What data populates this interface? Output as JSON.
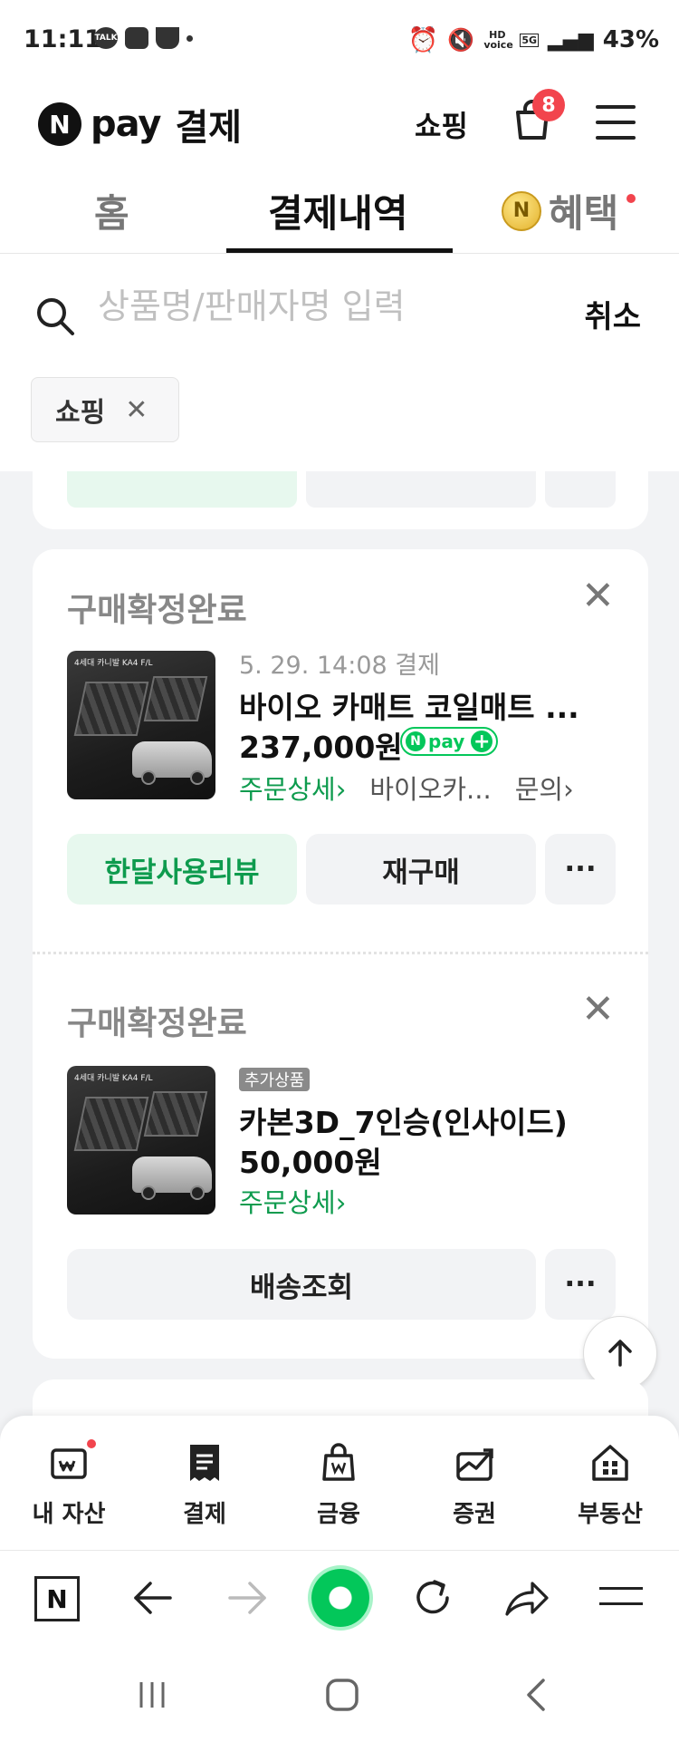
{
  "status_bar": {
    "time": "11:11",
    "left_icons": [
      "talk-icon",
      "image-icon",
      "coffee-icon"
    ],
    "network_label": "HD voice",
    "network_5g": "5G",
    "battery": "43%"
  },
  "header": {
    "logo_n": "N",
    "logo_pay": "pay",
    "title": "결제",
    "shop_label": "쇼핑",
    "cart_count": "8"
  },
  "tabs": {
    "home": "홈",
    "history": "결제내역",
    "benefit": "혜택",
    "benefit_coin": "N"
  },
  "search": {
    "placeholder": "상품명/판매자명 입력",
    "cancel": "취소",
    "filter_chip": "쇼핑",
    "filter_chip_close": "✕"
  },
  "orders": [
    {
      "status": "구매확정완료",
      "thumb_label": "4세대 카니발 KA4 F/L",
      "date": "5. 29. 14:08 결제",
      "name": "바이오 카매트 코일매트 ...",
      "price": "237,000원",
      "npay_badge": "pay",
      "links": [
        "주문상세›",
        "바이오카...",
        "문의›"
      ],
      "buttons": [
        "한달사용리뷰",
        "재구매",
        "···"
      ]
    },
    {
      "status": "구매확정완료",
      "thumb_label": "4세대 카니발 KA4 F/L",
      "tag": "추가상품",
      "name": "카본3D_7인승(인사이드)",
      "price": "50,000원",
      "links": [
        "주문상세›"
      ],
      "buttons": [
        "배송조회",
        "···"
      ]
    }
  ],
  "bottom_nav": [
    {
      "label": "내 자산",
      "icon": "wallet-icon"
    },
    {
      "label": "결제",
      "icon": "receipt-icon"
    },
    {
      "label": "금융",
      "icon": "money-bag-icon"
    },
    {
      "label": "증권",
      "icon": "stock-chart-icon"
    },
    {
      "label": "부동산",
      "icon": "building-icon"
    }
  ],
  "browser_bar": {
    "home_label": "N"
  },
  "colors": {
    "accent_green": "#03c75a",
    "link_green": "#0e9b4e",
    "badge_red": "#f2444d"
  }
}
